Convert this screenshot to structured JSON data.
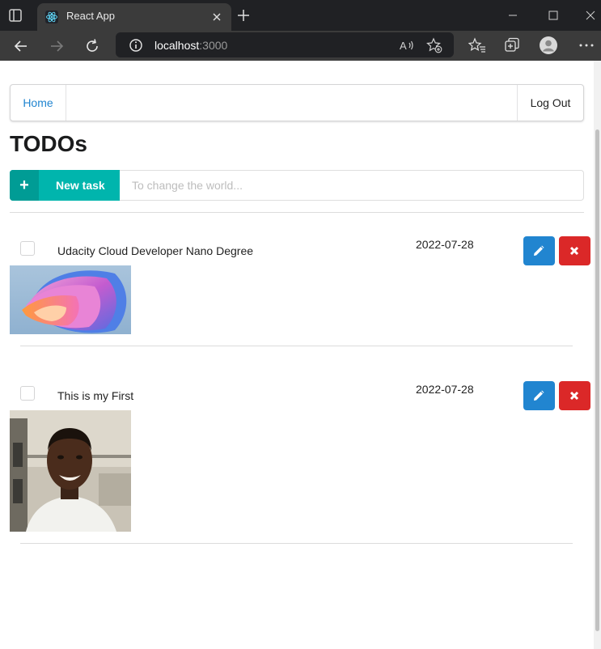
{
  "browser": {
    "tab_title": "React App",
    "url_host": "localhost",
    "url_port": ":3000",
    "colors": {
      "tabbar": "#202124",
      "toolbar": "#3b3b3b"
    }
  },
  "menu": {
    "home_label": "Home",
    "logout_label": "Log Out"
  },
  "page": {
    "title": "TODOs"
  },
  "new_task": {
    "button_label": "New task",
    "icon": "plus-icon",
    "input_value": "",
    "input_placeholder": "To change the world...",
    "color": "#00b5ad"
  },
  "todos": [
    {
      "name": "Udacity Cloud Developer Nano Degree",
      "due_date": "2022-07-28",
      "done": false,
      "image": "abstract-wallpaper-image"
    },
    {
      "name": "This is my First",
      "due_date": "2022-07-28",
      "done": false,
      "image": "portrait-photo-image"
    }
  ],
  "actions": {
    "edit_icon": "pencil-icon",
    "delete_icon": "x-icon",
    "edit_color": "#2185d0",
    "delete_color": "#db2828"
  }
}
